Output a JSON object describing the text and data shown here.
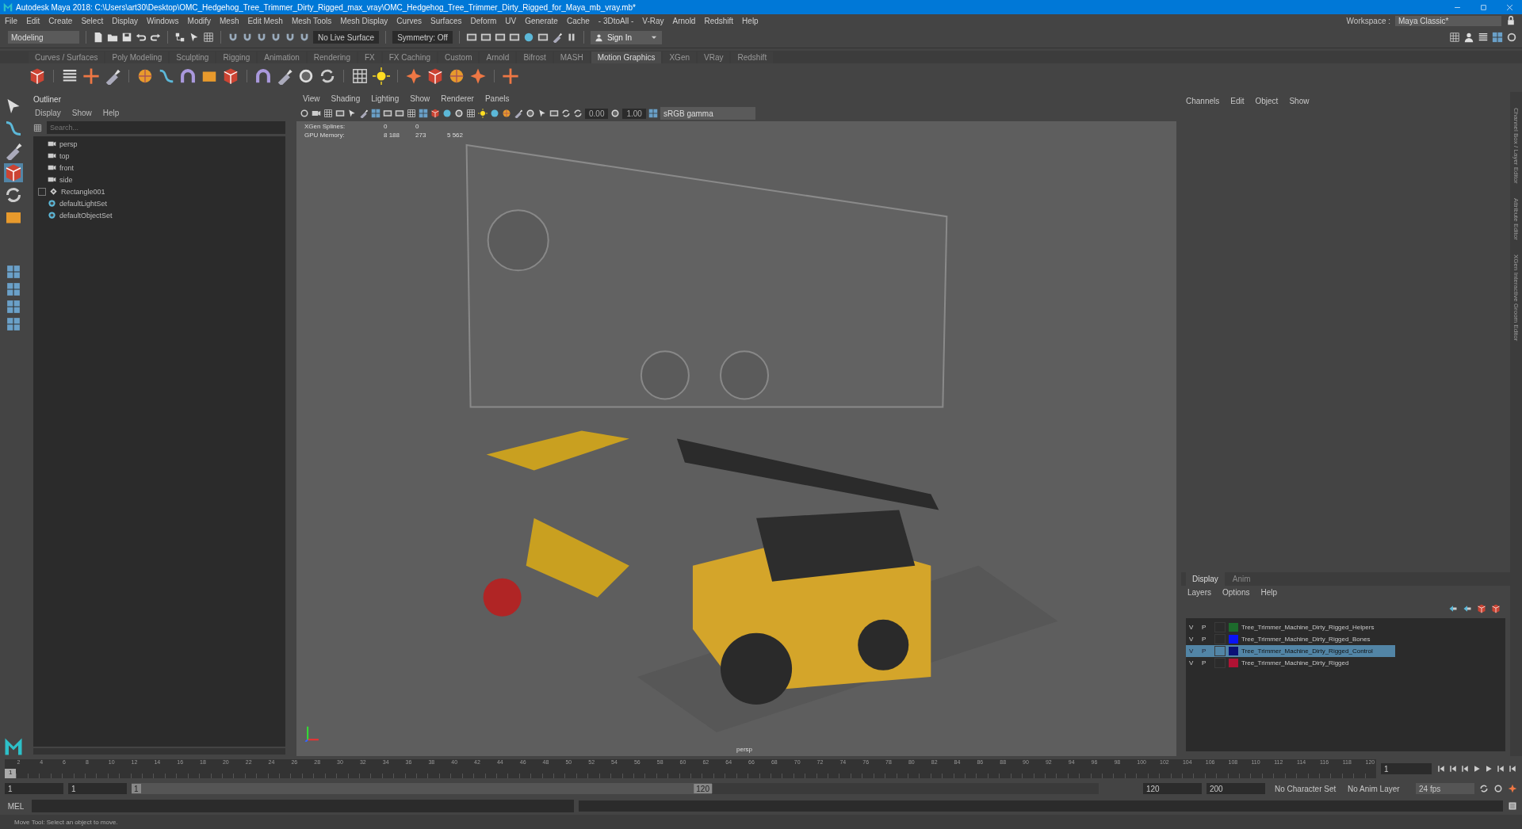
{
  "title_bar": {
    "title": "Autodesk Maya 2018: C:\\Users\\art30\\Desktop\\OMC_Hedgehog_Tree_Trimmer_Dirty_Rigged_max_vray\\OMC_Hedgehog_Tree_Trimmer_Dirty_Rigged_for_Maya_mb_vray.mb*"
  },
  "menu_bar": [
    "File",
    "Edit",
    "Create",
    "Select",
    "Display",
    "Windows",
    "Modify",
    "Mesh",
    "Edit Mesh",
    "Mesh Tools",
    "Mesh Display",
    "Curves",
    "Surfaces",
    "Deform",
    "UV",
    "Generate",
    "Cache",
    "- 3DtoAll -",
    "V-Ray",
    "Arnold",
    "Redshift",
    "Help"
  ],
  "workspace": {
    "label": "Workspace :",
    "value": "Maya Classic*"
  },
  "status_line": {
    "mode": "Modeling",
    "live_surface": "No Live Surface",
    "symmetry": "Symmetry: Off",
    "sign_in": "Sign In"
  },
  "shelf_tabs": [
    {
      "label": "Curves / Surfaces",
      "selected": false
    },
    {
      "label": "Poly Modeling",
      "selected": false
    },
    {
      "label": "Sculpting",
      "selected": false
    },
    {
      "label": "Rigging",
      "selected": false
    },
    {
      "label": "Animation",
      "selected": false
    },
    {
      "label": "Rendering",
      "selected": false
    },
    {
      "label": "FX",
      "selected": false
    },
    {
      "label": "FX Caching",
      "selected": false
    },
    {
      "label": "Custom",
      "selected": false
    },
    {
      "label": "Arnold",
      "selected": false
    },
    {
      "label": "Bifrost",
      "selected": false
    },
    {
      "label": "MASH",
      "selected": false
    },
    {
      "label": "Motion Graphics",
      "selected": true
    },
    {
      "label": "XGen",
      "selected": false
    },
    {
      "label": "VRay",
      "selected": false
    },
    {
      "label": "Redshift",
      "selected": false
    }
  ],
  "toolbox": [
    {
      "kind": "select",
      "selected": false
    },
    {
      "kind": "lasso",
      "selected": false
    },
    {
      "kind": "paint",
      "selected": false
    },
    {
      "kind": "move",
      "selected": true
    },
    {
      "kind": "rotate",
      "selected": false
    },
    {
      "kind": "scale",
      "selected": false
    }
  ],
  "outliner": {
    "title": "Outliner",
    "menus": [
      "Display",
      "Show",
      "Help"
    ],
    "search": {
      "placeholder": "Search..."
    },
    "items": [
      {
        "kind": "camera",
        "label": "persp"
      },
      {
        "kind": "camera",
        "label": "top"
      },
      {
        "kind": "camera",
        "label": "front"
      },
      {
        "kind": "camera",
        "label": "side"
      },
      {
        "kind": "group",
        "label": "Rectangle001"
      },
      {
        "kind": "set",
        "label": "defaultLightSet"
      },
      {
        "kind": "set",
        "label": "defaultObjectSet"
      }
    ]
  },
  "viewport": {
    "menus": [
      "View",
      "Shading",
      "Lighting",
      "Show",
      "Renderer",
      "Panels"
    ],
    "exposure": "0.00",
    "gamma": "1.00",
    "color_space": "sRGB gamma",
    "hud": [
      {
        "label": "XGen Splines:",
        "values": [
          "0",
          "0"
        ]
      },
      {
        "label": "GPU Memory:",
        "values": [
          "8 188",
          "273",
          "5 562"
        ]
      }
    ],
    "camera": "persp"
  },
  "channel_box": {
    "menus": [
      "Channels",
      "Edit",
      "Object",
      "Show"
    ]
  },
  "layer_editor": {
    "tabs": [
      {
        "label": "Display",
        "selected": true
      },
      {
        "label": "Anim",
        "selected": false
      }
    ],
    "menus": [
      "Layers",
      "Options",
      "Help"
    ],
    "layers": [
      {
        "visible": "V",
        "playback": "P",
        "name": "Tree_Trimmer_Machine_Dirty_Rigged_Helpers",
        "color": "#1d6b2c",
        "selected": false
      },
      {
        "visible": "V",
        "playback": "P",
        "name": "Tree_Trimmer_Machine_Dirty_Rigged_Bones",
        "color": "#0a14f5",
        "selected": false
      },
      {
        "visible": "V",
        "playback": "P",
        "name": "Tree_Trimmer_Machine_Dirty_Rigged_Control",
        "color": "#0b1177",
        "selected": true
      },
      {
        "visible": "V",
        "playback": "P",
        "name": "Tree_Trimmer_Machine_Dirty_Rigged",
        "color": "#b01234",
        "selected": false
      }
    ]
  },
  "side_tabs": [
    "Channel Box / Layer Editor",
    "Attribute Editor",
    "XGen Interactive Groom Editor"
  ],
  "timeline": {
    "current": "1",
    "ticks": [
      "2",
      "4",
      "6",
      "8",
      "10",
      "12",
      "14",
      "16",
      "18",
      "20",
      "22",
      "24",
      "26",
      "28",
      "30",
      "32",
      "34",
      "36",
      "38",
      "40",
      "42",
      "44",
      "46",
      "48",
      "50",
      "52",
      "54",
      "56",
      "58",
      "60",
      "62",
      "64",
      "66",
      "68",
      "70",
      "72",
      "74",
      "76",
      "78",
      "80",
      "82",
      "84",
      "86",
      "88",
      "90",
      "92",
      "94",
      "96",
      "98",
      "100",
      "102",
      "104",
      "106",
      "108",
      "110",
      "112",
      "114",
      "116",
      "118",
      "120"
    ],
    "frame": "1",
    "level": 0
  },
  "range": {
    "start": "1",
    "playback_start": "1",
    "slider_start": "1",
    "slider_end": "120",
    "playback_end": "120",
    "end": "200",
    "level": 0.6,
    "character_set": "No Character Set",
    "anim_layer": "No Anim Layer",
    "fps": "24 fps"
  },
  "command_line": {
    "language": "MEL"
  },
  "help_line": "Move Tool: Select an object to move."
}
